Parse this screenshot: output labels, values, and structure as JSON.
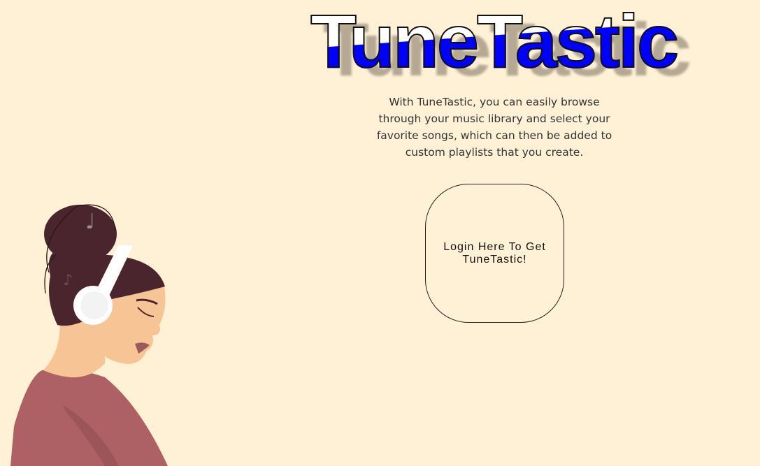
{
  "header": {
    "title": "TuneTastic"
  },
  "main": {
    "description": "With TuneTastic, you can easily browse through your music library and select your favorite songs, which can then be added to custom playlists that you create.",
    "login_button": "Login Here To Get TuneTastic!"
  },
  "colors": {
    "background": "#fff1d6",
    "title_fill": "#0000ff",
    "hair": "#4a252d",
    "shirt": "#ae6164",
    "skin": "#f6c495"
  },
  "illustration": {
    "subject": "woman-with-headphones-icon"
  }
}
